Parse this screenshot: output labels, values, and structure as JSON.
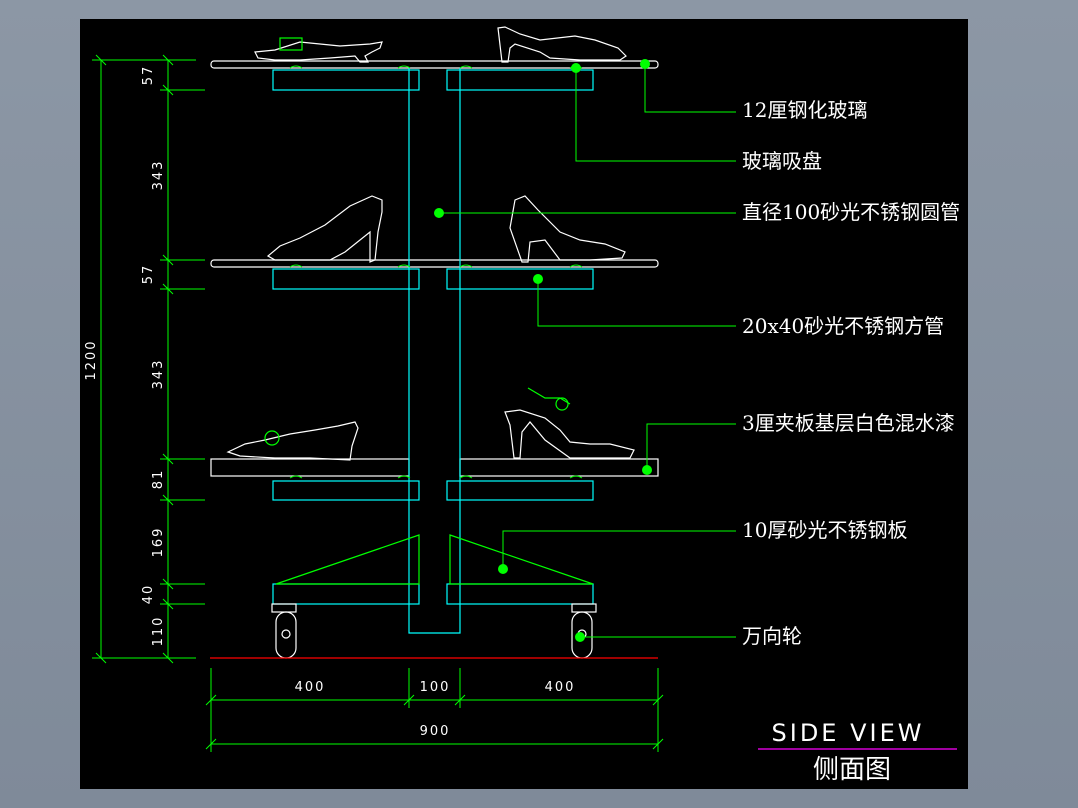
{
  "drawing": {
    "title_en": "SIDE  VIEW",
    "title_cn": "侧面图"
  },
  "dimensions": {
    "vertical_total": "1200",
    "vertical": [
      "57",
      "343",
      "57",
      "343",
      "81",
      "169",
      "40",
      "110"
    ],
    "horizontal_parts": [
      "400",
      "100",
      "400"
    ],
    "horizontal_total": "900"
  },
  "annotations": [
    "12厘钢化玻璃",
    "玻璃吸盘",
    "直径100砂光不锈钢圆管",
    "20x40砂光不锈钢方管",
    "3厘夹板基层白色混水漆",
    "10厚砂光不锈钢板",
    "万向轮"
  ],
  "colors": {
    "background": "#000000",
    "dimension": "#00ff00",
    "structure": "#00ffff",
    "shelf": "#ffffff",
    "ground": "#ff0000",
    "title_underline": "#ff00ff"
  }
}
